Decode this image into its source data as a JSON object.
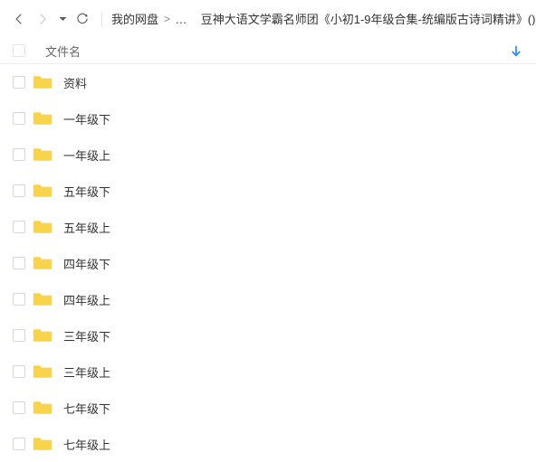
{
  "toolbar": {
    "back_icon": "chevron-left-icon",
    "forward_icon": "chevron-right-icon",
    "caret_icon": "caret-down-icon",
    "refresh_icon": "refresh-icon",
    "breadcrumb": [
      {
        "label": "我的网盘",
        "sep": ">"
      },
      {
        "label": "...",
        "sep": ""
      },
      {
        "label": "豆神大语文学霸名师团《小初1-9年级合集-统编版古诗词精讲》()",
        "sep": ">"
      }
    ]
  },
  "list_header": {
    "column_name": "文件名",
    "sort_icon": "arrow-down-icon",
    "sort_color": "#2a8cf0"
  },
  "colors": {
    "folder": "#f8d44c",
    "folder_tab": "#f5c93f",
    "text": "#333333",
    "muted": "#666666",
    "accent": "#2a8cf0"
  },
  "files": [
    {
      "name": "资料",
      "type": "folder"
    },
    {
      "name": "一年级下",
      "type": "folder"
    },
    {
      "name": "一年级上",
      "type": "folder"
    },
    {
      "name": "五年级下",
      "type": "folder"
    },
    {
      "name": "五年级上",
      "type": "folder"
    },
    {
      "name": "四年级下",
      "type": "folder"
    },
    {
      "name": "四年级上",
      "type": "folder"
    },
    {
      "name": "三年级下",
      "type": "folder"
    },
    {
      "name": "三年级上",
      "type": "folder"
    },
    {
      "name": "七年级下",
      "type": "folder"
    },
    {
      "name": "七年级上",
      "type": "folder"
    }
  ]
}
